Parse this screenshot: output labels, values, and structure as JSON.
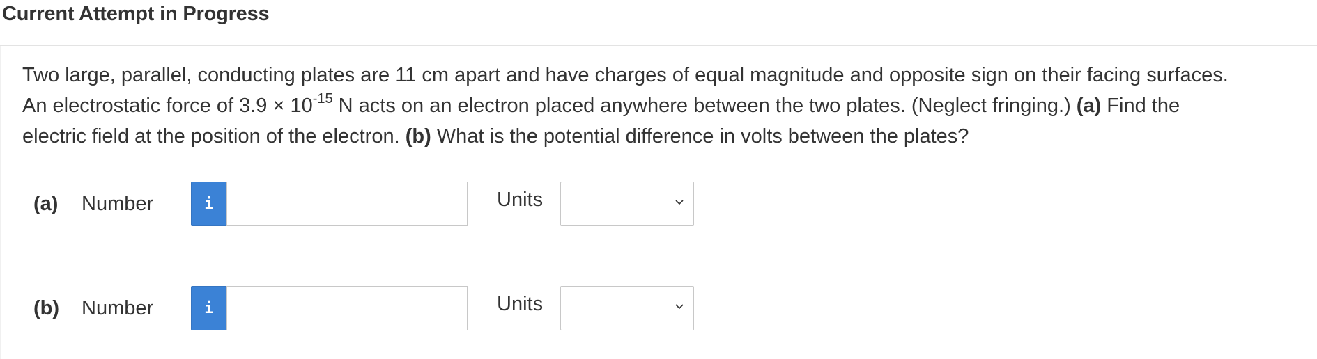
{
  "header": {
    "title": "Current Attempt in Progress"
  },
  "question": {
    "line1": "Two large, parallel, conducting plates are 11 cm apart and have charges of equal magnitude and opposite sign on their facing surfaces.",
    "line2_pre": "An electrostatic force of 3.9 × 10",
    "line2_exp": "-15",
    "line2_post": " N acts on an electron placed anywhere between the two plates. (Neglect fringing.) ",
    "part_a_marker": "(a)",
    "line2_end": " Find the",
    "line3_pre": "electric field at the position of the electron. ",
    "part_b_marker": "(b)",
    "line3_post": " What is the potential difference in volts between the plates?"
  },
  "answers": [
    {
      "part": "(a)",
      "number_label": "Number",
      "info_icon": "i",
      "number_value": "",
      "units_label": "Units",
      "units_selected": ""
    },
    {
      "part": "(b)",
      "number_label": "Number",
      "info_icon": "i",
      "number_value": "",
      "units_label": "Units",
      "units_selected": ""
    }
  ],
  "colors": {
    "info_button": "#3b82d6",
    "text": "#333333",
    "border": "#c8c8c8"
  }
}
